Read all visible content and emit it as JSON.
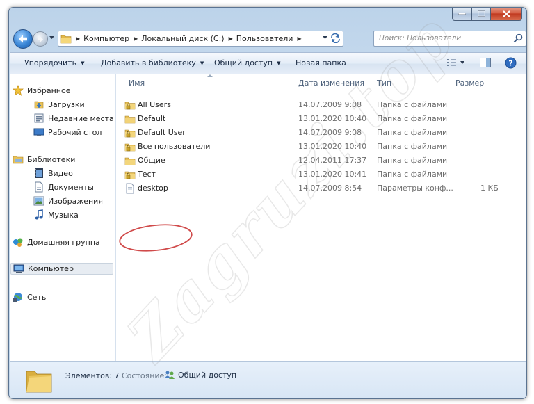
{
  "window": {
    "caption_buttons": [
      "minimize",
      "maximize",
      "close"
    ]
  },
  "address": {
    "breadcrumbs": [
      "Компьютер",
      "Локальный диск (C:)",
      "Пользователи"
    ],
    "search_placeholder": "Поиск: Пользователи"
  },
  "toolbar": {
    "organize": "Упорядочить",
    "add_to_library": "Добавить в библиотеку",
    "share": "Общий доступ",
    "new_folder": "Новая папка"
  },
  "nav": {
    "favorites": {
      "label": "Избранное",
      "items": [
        "Загрузки",
        "Недавние места",
        "Рабочий стол"
      ]
    },
    "libraries": {
      "label": "Библиотеки",
      "items": [
        "Видео",
        "Документы",
        "Изображения",
        "Музыка"
      ]
    },
    "homegroup": "Домашняя группа",
    "computer": "Компьютер",
    "network": "Сеть"
  },
  "columns": {
    "name": "Имя",
    "date": "Дата изменения",
    "type": "Тип",
    "size": "Размер"
  },
  "files": [
    {
      "name": "All Users",
      "date": "14.07.2009 9:08",
      "type": "Папка с файлами",
      "size": "",
      "icon": "locked-folder-icon"
    },
    {
      "name": "Default",
      "date": "13.01.2020 10:40",
      "type": "Папка с файлами",
      "size": "",
      "icon": "folder-icon"
    },
    {
      "name": "Default User",
      "date": "14.07.2009 9:08",
      "type": "Папка с файлами",
      "size": "",
      "icon": "locked-folder-icon"
    },
    {
      "name": "Все пользователи",
      "date": "13.01.2020 10:40",
      "type": "Папка с файлами",
      "size": "",
      "icon": "locked-folder-icon"
    },
    {
      "name": "Общие",
      "date": "12.04.2011 17:37",
      "type": "Папка с файлами",
      "size": "",
      "icon": "folder-icon"
    },
    {
      "name": "Тест",
      "date": "13.01.2020 10:41",
      "type": "Папка с файлами",
      "size": "",
      "icon": "locked-folder-icon"
    },
    {
      "name": "desktop",
      "date": "14.07.2009 8:54",
      "type": "Параметры конф...",
      "size": "1 КБ",
      "icon": "settings-file-icon"
    }
  ],
  "details": {
    "count": "Элементов: 7",
    "state_label": "Состояние:",
    "state_value": "Общий доступ"
  },
  "watermark": "Zagruzi.top",
  "colors": {
    "annotation": "#d04a4a",
    "folder": "#e8c25a",
    "lock": "#c9a227"
  }
}
